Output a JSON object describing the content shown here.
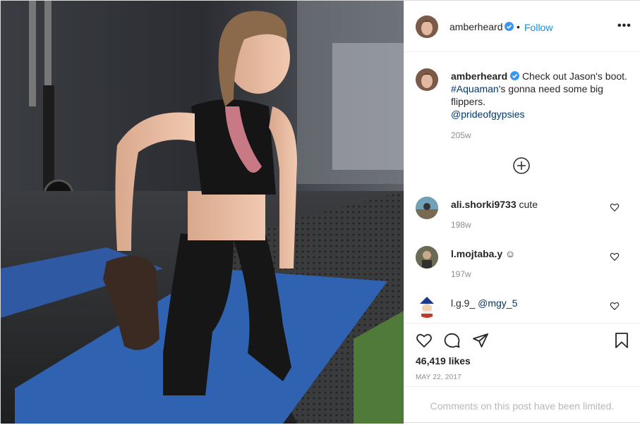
{
  "post": {
    "author": "amberheard",
    "follow_label": "Follow",
    "separator": "•",
    "more_label": "•••",
    "photo_alt": "Photo by amberheard"
  },
  "caption": {
    "username": "amberheard",
    "text": "Check out Jason's boot.",
    "hashtag": "#Aquaman",
    "text2": "'s gonna need some big flippers.",
    "mention": "@prideofgypsies",
    "time": "205w"
  },
  "comments": [
    {
      "username": "ali.shorki9733",
      "text": "cute",
      "time": "198w"
    },
    {
      "username": "l.mojtaba.y",
      "text": "☺",
      "time": "197w"
    },
    {
      "username": "l.g.9_",
      "text": "@mgy_5",
      "time": ""
    }
  ],
  "stats": {
    "likes": "46,419 likes",
    "date": "MAY 22, 2017"
  },
  "footer": {
    "limited": "Comments on this post have been limited."
  },
  "icons": {
    "verified_color": "#3897f0",
    "link_color": "#00376b",
    "follow_color": "#0095f6"
  }
}
